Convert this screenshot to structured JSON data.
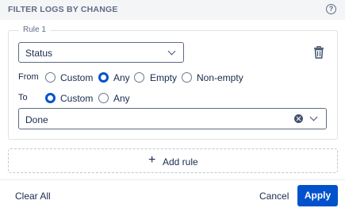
{
  "header": {
    "title": "FILTER LOGS BY CHANGE",
    "help_icon": "question-circle-icon",
    "help_glyph": "?"
  },
  "rule": {
    "legend": "Rule 1",
    "field": {
      "value": "Status"
    },
    "delete_icon": "trash-icon",
    "from": {
      "label": "From",
      "options": [
        "Custom",
        "Any",
        "Empty",
        "Non-empty"
      ],
      "selected": "Any"
    },
    "to": {
      "label": "To",
      "options": [
        "Custom",
        "Any"
      ],
      "selected": "Custom"
    },
    "value_field": {
      "value": "Done",
      "clear_icon": "clear-circle-icon"
    }
  },
  "add_rule": {
    "icon": "plus-icon",
    "glyph": "+",
    "label": "Add rule"
  },
  "footer": {
    "clear_all": "Clear All",
    "cancel": "Cancel",
    "apply": "Apply"
  },
  "colors": {
    "accent": "#0052cc",
    "header_bg": "#f4f5f7",
    "text": "#172b4d"
  }
}
